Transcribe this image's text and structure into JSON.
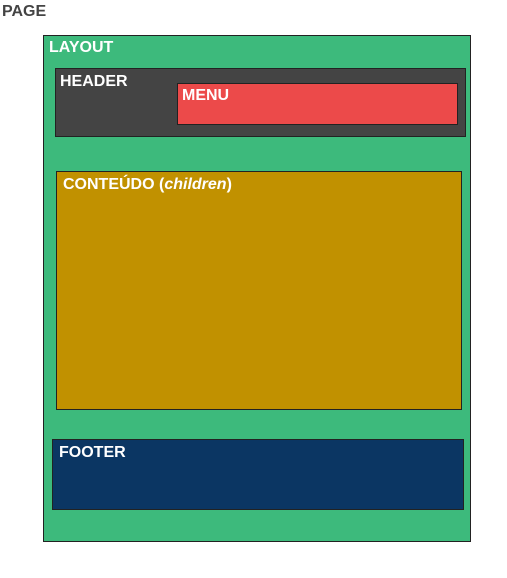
{
  "page": {
    "label": "PAGE",
    "color": "#ffffff"
  },
  "layout": {
    "label": "LAYOUT",
    "color": "#3dba7c"
  },
  "header": {
    "label": "HEADER",
    "color": "#444444"
  },
  "menu": {
    "label": "MENU",
    "color": "#ec4a4a"
  },
  "content": {
    "label_prefix": "CONTEÚDO (",
    "label_italic": "children",
    "label_suffix": ")",
    "color": "#c19100"
  },
  "footer": {
    "label": "FOOTER",
    "color": "#0b3663"
  }
}
